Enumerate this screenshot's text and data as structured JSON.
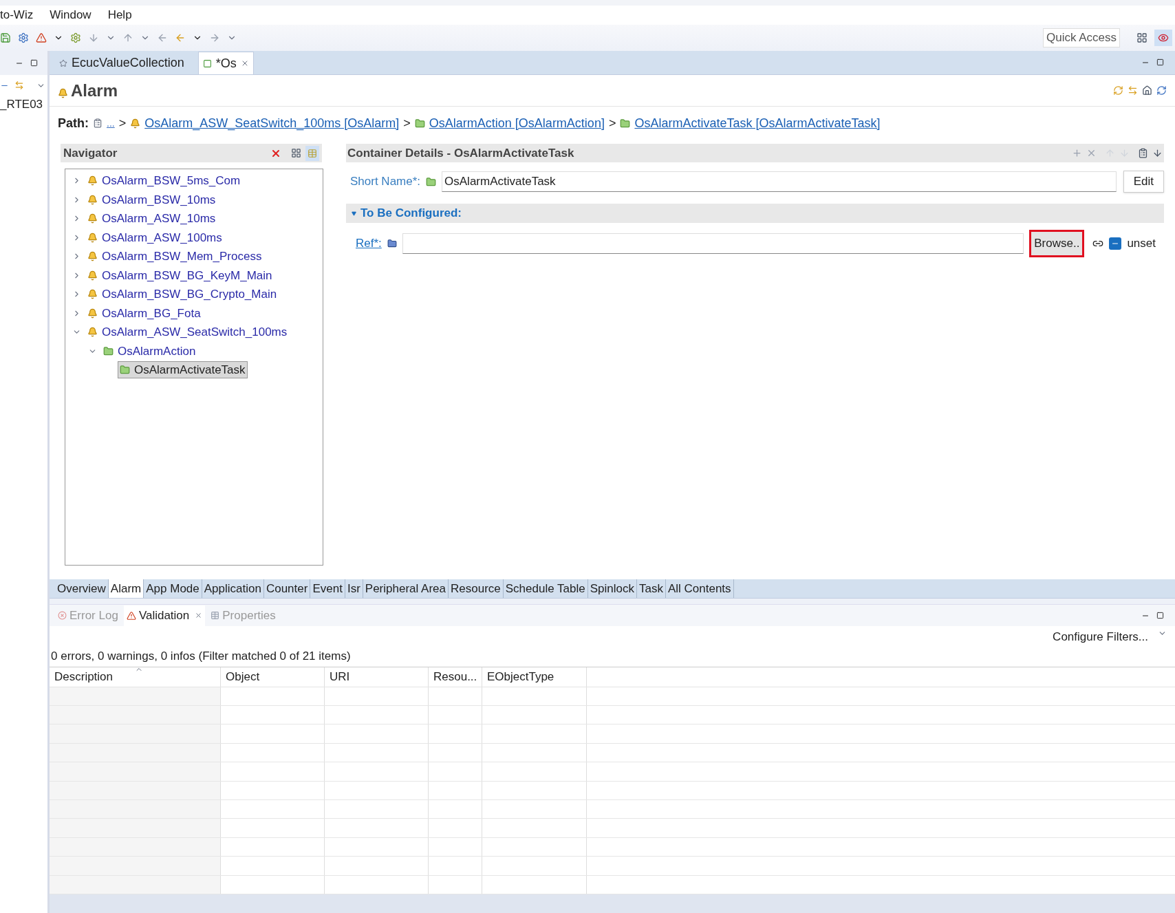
{
  "menu_bar": {
    "items": [
      "to-Wiz",
      "Window",
      "Help"
    ]
  },
  "toolbar": {
    "quick_access": "Quick Access"
  },
  "left_panel": {
    "item": "_RTE03"
  },
  "editor_tabs": [
    {
      "label": "EcucValueCollection",
      "selected": false,
      "closable": false
    },
    {
      "label": "*Os",
      "selected": true,
      "closable": true
    }
  ],
  "page": {
    "title": "Alarm",
    "path_label": "Path:",
    "path_more": "...",
    "path_separator": ">",
    "path": [
      {
        "kind": "alarm",
        "label": "OsAlarm_ASW_SeatSwitch_100ms [OsAlarm]"
      },
      {
        "kind": "folder",
        "label": "OsAlarmAction [OsAlarmAction]"
      },
      {
        "kind": "folder",
        "label": "OsAlarmActivateTask [OsAlarmActivateTask]"
      }
    ]
  },
  "navigator": {
    "title": "Navigator",
    "tree": [
      {
        "kind": "alarm",
        "label": "OsAlarm_BSW_5ms_Com",
        "expanded": false,
        "selected": false
      },
      {
        "kind": "alarm",
        "label": "OsAlarm_BSW_10ms",
        "expanded": false,
        "selected": false
      },
      {
        "kind": "alarm",
        "label": "OsAlarm_ASW_10ms",
        "expanded": false,
        "selected": false
      },
      {
        "kind": "alarm",
        "label": "OsAlarm_ASW_100ms",
        "expanded": false,
        "selected": false
      },
      {
        "kind": "alarm",
        "label": "OsAlarm_BSW_Mem_Process",
        "expanded": false,
        "selected": false
      },
      {
        "kind": "alarm",
        "label": "OsAlarm_BSW_BG_KeyM_Main",
        "expanded": false,
        "selected": false
      },
      {
        "kind": "alarm",
        "label": "OsAlarm_BSW_BG_Crypto_Main",
        "expanded": false,
        "selected": false
      },
      {
        "kind": "alarm",
        "label": "OsAlarm_BG_Fota",
        "expanded": false,
        "selected": false
      },
      {
        "kind": "alarm",
        "label": "OsAlarm_ASW_SeatSwitch_100ms",
        "expanded": true,
        "selected": false,
        "children": [
          {
            "kind": "folder",
            "label": "OsAlarmAction",
            "expanded": true,
            "selected": false,
            "children": [
              {
                "kind": "leaf",
                "label": "OsAlarmActivateTask",
                "selected": true
              }
            ]
          }
        ]
      }
    ]
  },
  "details": {
    "title": "Container Details - OsAlarmActivateTask",
    "short_name_label": "Short Name*:",
    "short_name": "OsAlarmActivateTask",
    "edit_button": "Edit",
    "section": {
      "title": "To Be Configured:",
      "expanded": true
    },
    "ref_label": "Ref*:",
    "browse_button": "Browse..",
    "browse_highlighted": true,
    "unset": "unset"
  },
  "page_tabs": [
    {
      "label": "Overview",
      "selected": false
    },
    {
      "label": "Alarm",
      "selected": true
    },
    {
      "label": "App Mode",
      "selected": false
    },
    {
      "label": "Application",
      "selected": false
    },
    {
      "label": "Counter",
      "selected": false
    },
    {
      "label": "Event",
      "selected": false
    },
    {
      "label": "Isr",
      "selected": false
    },
    {
      "label": "Peripheral Area",
      "selected": false
    },
    {
      "label": "Resource",
      "selected": false
    },
    {
      "label": "Schedule Table",
      "selected": false
    },
    {
      "label": "Spinlock",
      "selected": false
    },
    {
      "label": "Task",
      "selected": false
    },
    {
      "label": "All Contents",
      "selected": false
    }
  ],
  "view_tabs": [
    {
      "kind": "error",
      "label": "Error Log",
      "selected": false,
      "closable": false
    },
    {
      "kind": "validation",
      "label": "Validation",
      "selected": true,
      "closable": true
    },
    {
      "kind": "properties",
      "label": "Properties",
      "selected": false,
      "closable": false
    }
  ],
  "validation": {
    "configure_filters": "Configure Filters...",
    "summary": "0 errors, 0 warnings, 0 infos (Filter matched 0 of 21 items)",
    "columns": [
      {
        "label": "Description",
        "sorted": true
      },
      {
        "label": "Object",
        "sorted": false
      },
      {
        "label": "URI",
        "sorted": false
      },
      {
        "label": "Resou...",
        "sorted": false
      },
      {
        "label": "EObjectType",
        "sorted": false
      }
    ]
  }
}
